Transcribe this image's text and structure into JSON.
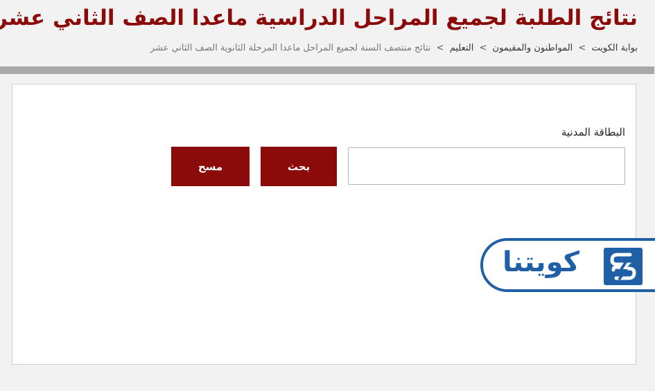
{
  "header": {
    "title": "نتائج الطلبة لجميع المراحل الدراسية ماعدا الصف الثاني عشر",
    "breadcrumb": [
      "بوابة الكويت",
      "المواطنون والمقيمون",
      "التعليم",
      "نتائج منتصف السنة لجميع المراحل ماعدا المرحلة الثانوية الصف الثاني عشر"
    ],
    "breadcrumb_separator": ">"
  },
  "form": {
    "civil_id_label": "البطاقة المدنية",
    "civil_id_value": "",
    "search_label": "بحث",
    "clear_label": "مسح"
  },
  "watermark": {
    "logo_text": "كويتنا",
    "icon": "lightning-s-icon"
  },
  "colors": {
    "brand": "#8b0a0a",
    "logo_blue": "#1f5fa6"
  }
}
